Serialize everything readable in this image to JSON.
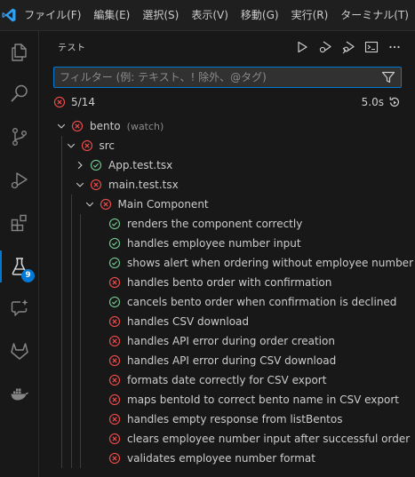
{
  "menu": {
    "items": [
      "ファイル(F)",
      "編集(E)",
      "選択(S)",
      "表示(V)",
      "移動(G)",
      "実行(R)",
      "ターミナル(T)"
    ]
  },
  "activity_bar": {
    "items": [
      {
        "name": "explorer",
        "icon": "files-icon"
      },
      {
        "name": "search",
        "icon": "search-icon"
      },
      {
        "name": "source-control",
        "icon": "source-control-icon"
      },
      {
        "name": "run-debug",
        "icon": "run-debug-icon"
      },
      {
        "name": "extensions",
        "icon": "extensions-icon"
      },
      {
        "name": "testing",
        "icon": "beaker-icon",
        "badge": "9",
        "active": true
      },
      {
        "name": "chat",
        "icon": "chat-sparkle-icon"
      },
      {
        "name": "gitlab",
        "icon": "gitlab-icon"
      },
      {
        "name": "docker",
        "icon": "docker-icon"
      }
    ]
  },
  "panel": {
    "title": "テスト",
    "filter_placeholder": "フィルター (例: テキスト、! 除外、@タグ)",
    "summary": {
      "count": "5/14",
      "duration": "5.0s"
    }
  },
  "colors": {
    "pass": "#73c991",
    "fail": "#f14c4c",
    "accent": "#0078d4"
  },
  "tree": [
    {
      "label": "bento",
      "desc": "(watch)",
      "status": "fail",
      "expanded": true,
      "depth": 0
    },
    {
      "label": "src",
      "status": "fail",
      "expanded": true,
      "depth": 1
    },
    {
      "label": "App.test.tsx",
      "status": "pass",
      "expanded": false,
      "depth": 2
    },
    {
      "label": "main.test.tsx",
      "status": "fail",
      "expanded": true,
      "depth": 2
    },
    {
      "label": "Main Component",
      "status": "fail",
      "expanded": true,
      "depth": 3
    },
    {
      "label": "renders the component correctly",
      "status": "pass",
      "depth": 4
    },
    {
      "label": "handles employee number input",
      "status": "pass",
      "depth": 4
    },
    {
      "label": "shows alert when ordering without employee number",
      "status": "pass",
      "depth": 4
    },
    {
      "label": "handles bento order with confirmation",
      "status": "fail",
      "depth": 4
    },
    {
      "label": "cancels bento order when confirmation is declined",
      "status": "pass",
      "depth": 4
    },
    {
      "label": "handles CSV download",
      "status": "fail",
      "depth": 4
    },
    {
      "label": "handles API error during order creation",
      "status": "fail",
      "depth": 4
    },
    {
      "label": "handles API error during CSV download",
      "status": "fail",
      "depth": 4
    },
    {
      "label": "formats date correctly for CSV export",
      "status": "fail",
      "depth": 4
    },
    {
      "label": "maps bentoId to correct bento name in CSV export",
      "status": "fail",
      "depth": 4
    },
    {
      "label": "handles empty response from listBentos",
      "status": "fail",
      "depth": 4
    },
    {
      "label": "clears employee number input after successful order",
      "status": "fail",
      "depth": 4
    },
    {
      "label": "validates employee number format",
      "status": "fail",
      "depth": 4
    }
  ]
}
